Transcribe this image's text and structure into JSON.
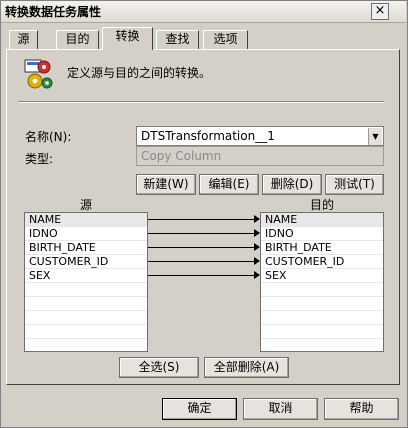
{
  "window": {
    "title": "转换数据任务属性",
    "close_glyph": "×"
  },
  "tabs": [
    "源",
    "目的",
    "转换",
    "查找",
    "选项"
  ],
  "active_tab": 2,
  "intro": {
    "text": "定义源与目的之间的转换。",
    "icon": "transform-gears-icon"
  },
  "fields": {
    "name_label": "名称(N):",
    "name_value": "DTSTransformation__1",
    "type_label": "类型:",
    "type_value": "Copy Column"
  },
  "buttons": {
    "new": "新建(W)",
    "edit": "编辑(E)",
    "delete": "删除(D)",
    "test": "测试(T)",
    "select_all": "全选(S)",
    "delete_all": "全部删除(A)",
    "ok": "确定",
    "cancel": "取消",
    "help": "帮助"
  },
  "source": {
    "header": "源",
    "columns": [
      "NAME",
      "IDNO",
      "BIRTH_DATE",
      "CUSTOMER_ID",
      "SEX"
    ]
  },
  "destination": {
    "header": "目的",
    "columns": [
      "NAME",
      "IDNO",
      "BIRTH_DATE",
      "CUSTOMER_ID",
      "SEX"
    ]
  }
}
